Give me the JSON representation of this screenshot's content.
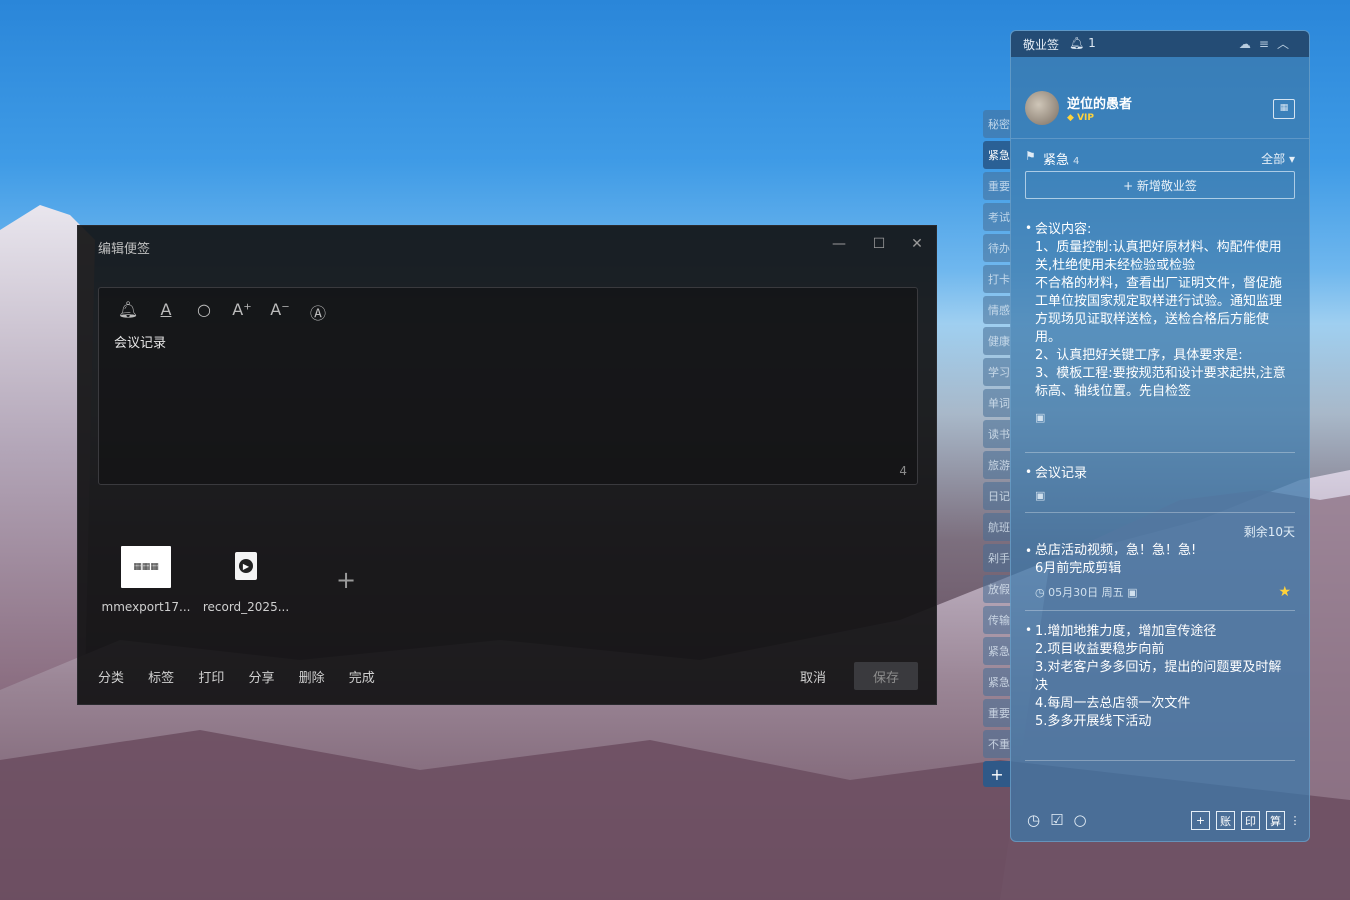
{
  "editor": {
    "title": "编辑便签",
    "note_text": "会议记录",
    "char_count": "4",
    "toolbar": {
      "reminder_icon": "bell-icon",
      "font_color_icon": "font-color-icon",
      "search_icon": "search-icon",
      "increase_font_icon": "font-increase-icon",
      "decrease_font_icon": "font-decrease-icon",
      "font_style_icon": "font-style-icon"
    },
    "attachments": [
      {
        "label": "mmexport17..."
      },
      {
        "label": "record_2025..."
      }
    ],
    "actions": [
      "分类",
      "标签",
      "打印",
      "分享",
      "删除",
      "完成"
    ],
    "cancel_label": "取消",
    "save_label": "保存"
  },
  "side_tabs": [
    "秘密",
    "紧急",
    "重要",
    "考试",
    "待办",
    "打卡",
    "情感",
    "健康",
    "学习",
    "单词",
    "读书",
    "旅游",
    "日记",
    "航班",
    "剁手",
    "放假",
    "传输",
    "紧急",
    "紧急",
    "重要",
    "不重"
  ],
  "panel": {
    "app_name": "敬业签",
    "notify_count": "1",
    "username": "逆位的愚者",
    "vip_label": "VIP",
    "category_name": "紧急",
    "category_count": "4",
    "filter_label": "全部",
    "new_note_label": "+ 新增敬业签",
    "notes": [
      {
        "lines": [
          "会议内容:",
          "1、质量控制:认真把好原材料、构配件使用",
          "关,杜绝使用未经检验或检验",
          "不合格的材料，查看出厂证明文件，督促施",
          "工单位按国家规定取样进行试验。通知监理",
          "方现场见证取样送检，送检合格后方能使",
          "用。",
          "2、认真把好关键工序，具体要求是:",
          "3、模板工程:要按规范和设计要求起拱,注意",
          "标高、轴线位置。先自检签"
        ]
      },
      {
        "lines": [
          "会议记录"
        ]
      },
      {
        "remain": "剩余10天",
        "lines": [
          "总店活动视频，急！急！急!",
          "6月前完成剪辑"
        ],
        "date": "05月30日 周五"
      },
      {
        "lines": [
          "1.增加地推力度，增加宣传途径",
          "2.项目收益要稳步向前",
          "3.对老客户多多回访，提出的问题要及时解",
          "决",
          "4.每周一去总店领一次文件",
          "5.多多开展线下活动"
        ]
      }
    ],
    "bottom_tools": [
      "账",
      "印",
      "算"
    ]
  }
}
